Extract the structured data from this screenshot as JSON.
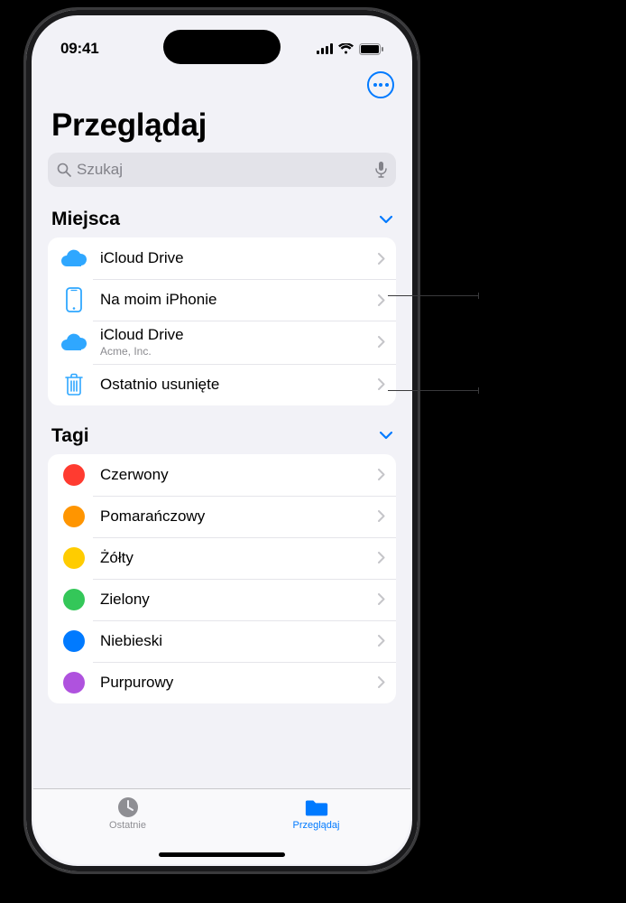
{
  "status": {
    "time": "09:41"
  },
  "title": "Przeglądaj",
  "search": {
    "placeholder": "Szukaj"
  },
  "sections": {
    "locations": {
      "header": "Miejsca",
      "items": [
        {
          "label": "iCloud Drive",
          "sub": ""
        },
        {
          "label": "Na moim iPhonie",
          "sub": ""
        },
        {
          "label": "iCloud Drive",
          "sub": "Acme, Inc."
        },
        {
          "label": "Ostatnio usunięte",
          "sub": ""
        }
      ]
    },
    "tags": {
      "header": "Tagi",
      "items": [
        {
          "label": "Czerwony",
          "color": "tag-red"
        },
        {
          "label": "Pomarańczowy",
          "color": "tag-orange"
        },
        {
          "label": "Żółty",
          "color": "tag-yellow"
        },
        {
          "label": "Zielony",
          "color": "tag-green"
        },
        {
          "label": "Niebieski",
          "color": "tag-blue"
        },
        {
          "label": "Purpurowy",
          "color": "tag-purple"
        }
      ]
    }
  },
  "tabs": {
    "recent": "Ostatnie",
    "browse": "Przeglądaj"
  }
}
